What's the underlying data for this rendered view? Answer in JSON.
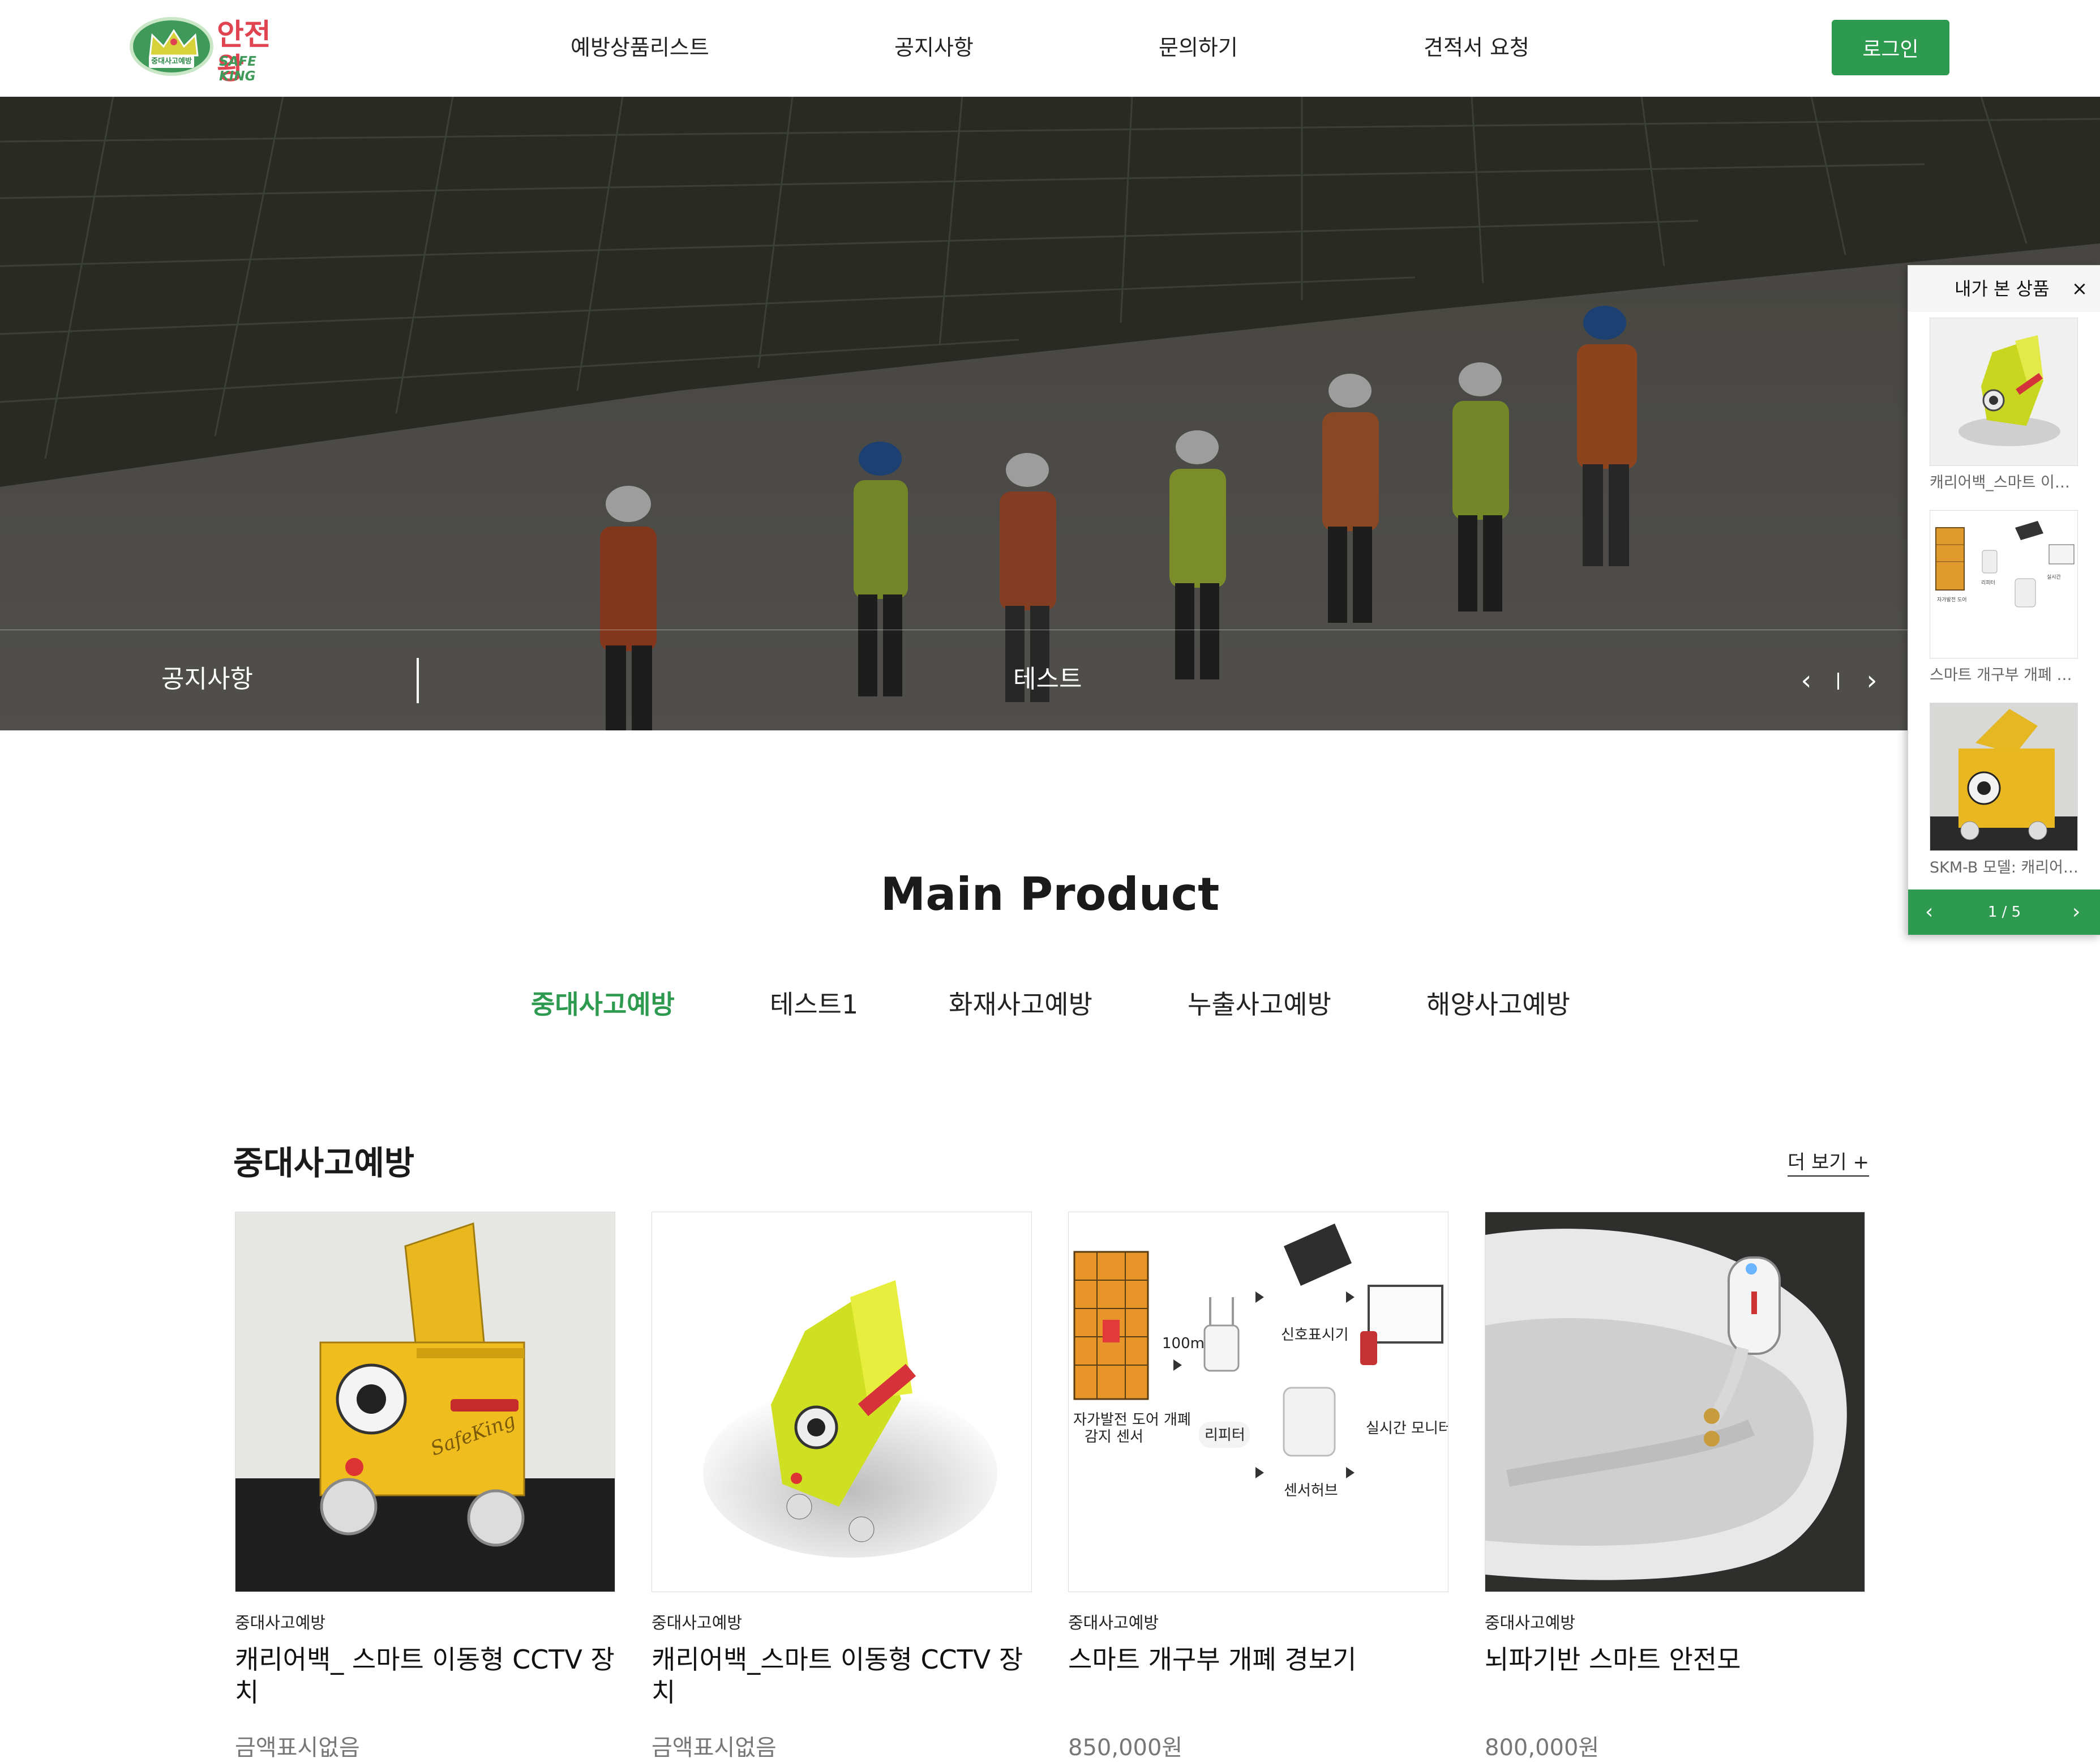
{
  "header": {
    "logo": {
      "kr": "안전왕",
      "en": "SAFE KING",
      "badge": "중대사고예방"
    },
    "nav": [
      "예방상품리스트",
      "공지사항",
      "문의하기",
      "견적서 요청"
    ],
    "login_label": "로그인"
  },
  "hero": {
    "notice_label": "공지사항",
    "notice_text": "테스트",
    "prev": "‹",
    "next": "›"
  },
  "recent": {
    "title": "내가 본 상품",
    "close": "×",
    "items": [
      {
        "name": "캐리어백_스마트 이동형 CCTV 장치"
      },
      {
        "name": "스마트 개구부 개폐 경보기"
      },
      {
        "name": "SKM-B 모델: 캐리어백 스마트 이동형 CCTV 장치"
      }
    ],
    "pager": {
      "prev": "‹",
      "count": "1 / 5",
      "next": "›"
    }
  },
  "main": {
    "title": "Main Product",
    "tabs": [
      "중대사고예방",
      "테스트1",
      "화재사고예방",
      "누출사고예방",
      "해양사고예방"
    ],
    "active_tab": "중대사고예방",
    "section_title": "중대사고예방",
    "more": "더 보기 +"
  },
  "products": [
    {
      "category": "중대사고예방",
      "name": "캐리어백_ 스마트 이동형 CCTV 장치",
      "price": "금액표시없음"
    },
    {
      "category": "중대사고예방",
      "name": "캐리어백_스마트 이동형 CCTV 장치",
      "price": "금액표시없음"
    },
    {
      "category": "중대사고예방",
      "name": "스마트 개구부 개폐 경보기",
      "price": "850,000원"
    },
    {
      "category": "중대사고예방",
      "name": "뇌파기반 스마트 안전모",
      "price": "800,000원"
    }
  ],
  "product2_diagram": {
    "labels": [
      "자가발전 도어 개폐\n감지 센서",
      "100m",
      "리피터",
      "신호표시기",
      "센서허브",
      "실시간 모니터링"
    ]
  },
  "product1_brand": "SafeKing",
  "colors": {
    "accent": "#2e9a4f",
    "logo_red": "#e04450"
  }
}
